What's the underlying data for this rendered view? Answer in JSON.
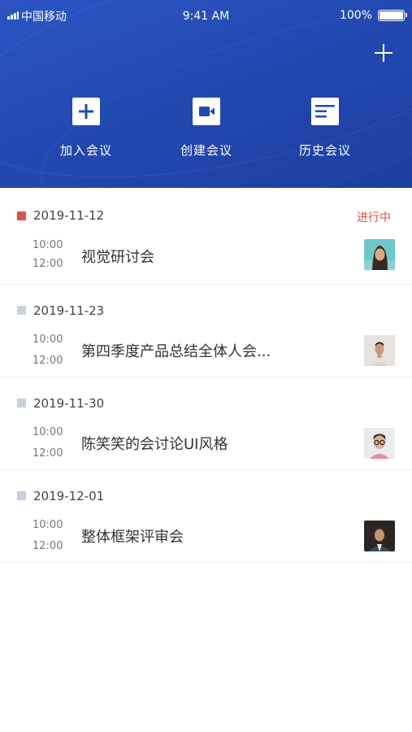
{
  "status_bar": {
    "carrier": "中国移动",
    "time": "9:41 AM",
    "battery": "100%"
  },
  "header": {
    "add_icon": "plus-icon",
    "actions": [
      {
        "label": "加入会议",
        "icon": "plus-square-icon"
      },
      {
        "label": "创建会议",
        "icon": "video-camera-icon"
      },
      {
        "label": "历史会议",
        "icon": "history-list-icon"
      }
    ]
  },
  "colors": {
    "header_blue": "#2349b2",
    "status_active": "#e0504b",
    "dot_inactive": "#c9d0df"
  },
  "meetings": [
    {
      "date": "2019-11-12",
      "status": "进行中",
      "start": "10:00",
      "end": "12:00",
      "title": "视觉研讨会",
      "avatar": "avatar-woman-icon"
    },
    {
      "date": "2019-11-23",
      "status": "",
      "start": "10:00",
      "end": "12:00",
      "title": "第四季度产品总结全体人会...",
      "avatar": "avatar-man-icon"
    },
    {
      "date": "2019-11-30",
      "status": "",
      "start": "10:00",
      "end": "12:00",
      "title": "陈笑笑的会讨论UI风格",
      "avatar": "avatar-glasses-icon"
    },
    {
      "date": "2019-12-01",
      "status": "",
      "start": "10:00",
      "end": "12:00",
      "title": "整体框架评审会",
      "avatar": "avatar-suit-icon"
    }
  ]
}
